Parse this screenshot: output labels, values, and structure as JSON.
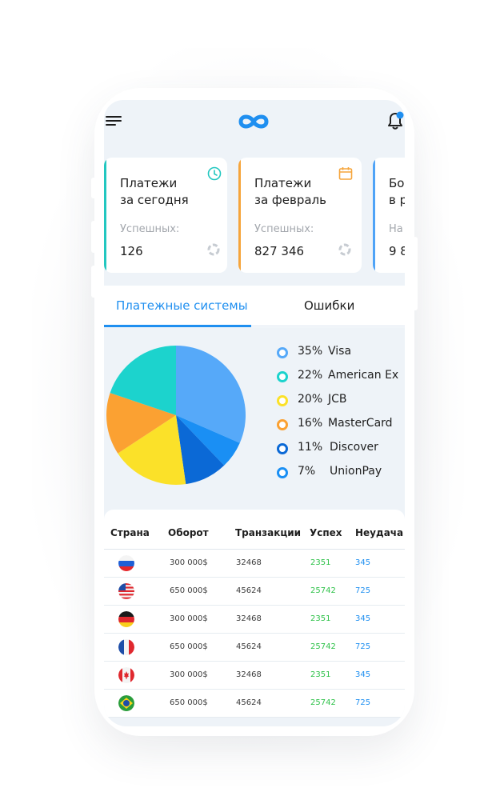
{
  "header": {
    "menu_icon": "hamburger-menu-icon",
    "logo_icon": "infinity-logo-icon",
    "notification_icon": "bell-icon"
  },
  "cards": [
    {
      "title_line1": "Платежи",
      "title_line2": "за сегодня",
      "label": "Успешных:",
      "value": "126",
      "accent": "#22c7c0",
      "icon": "clock-icon"
    },
    {
      "title_line1": "Платежи",
      "title_line2": "за февраль",
      "label": "Успешных:",
      "value": "827 346",
      "accent": "#f6a53c",
      "icon": "calendar-icon"
    },
    {
      "title_line1": "Бо",
      "title_line2": "в р",
      "label": "На",
      "value": "9 8",
      "accent": "#4fa3f7",
      "icon": ""
    }
  ],
  "tabs": [
    {
      "label": "Платежные системы",
      "active": true
    },
    {
      "label": "Ошибки",
      "active": false
    }
  ],
  "chart_data": {
    "type": "pie",
    "slices": [
      {
        "label": "Visa",
        "percent": 35,
        "pct_text": "35%",
        "color": "#56a9f9"
      },
      {
        "label": "American Ex",
        "percent": 22,
        "pct_text": "22%",
        "color": "#1cd3cd"
      },
      {
        "label": "JCB",
        "percent": 20,
        "pct_text": "20%",
        "color": "#fbe129"
      },
      {
        "label": "MasterCard",
        "percent": 16,
        "pct_text": "16%",
        "color": "#fba132"
      },
      {
        "label": "Discover",
        "percent": 11,
        "pct_text": "11%",
        "color": "#0b69d6"
      },
      {
        "label": "UnionPay",
        "percent": 7,
        "pct_text": "7%",
        "color": "#1a8ff4"
      }
    ]
  },
  "table": {
    "headers": [
      "Страна",
      "Оборот",
      "Транзакции",
      "Успех",
      "Неудача"
    ],
    "rows": [
      {
        "flag": "russia-flag-icon",
        "turnover": "300 000$",
        "transactions": "32468",
        "success": "2351",
        "fail": "345"
      },
      {
        "flag": "usa-flag-icon",
        "turnover": "650 000$",
        "transactions": "45624",
        "success": "25742",
        "fail": "725"
      },
      {
        "flag": "germany-flag-icon",
        "turnover": "300 000$",
        "transactions": "32468",
        "success": "2351",
        "fail": "345"
      },
      {
        "flag": "france-flag-icon",
        "turnover": "650 000$",
        "transactions": "45624",
        "success": "25742",
        "fail": "725"
      },
      {
        "flag": "canada-flag-icon",
        "turnover": "300 000$",
        "transactions": "32468",
        "success": "2351",
        "fail": "345"
      },
      {
        "flag": "brazil-flag-icon",
        "turnover": "650 000$",
        "transactions": "45624",
        "success": "25742",
        "fail": "725"
      }
    ]
  }
}
